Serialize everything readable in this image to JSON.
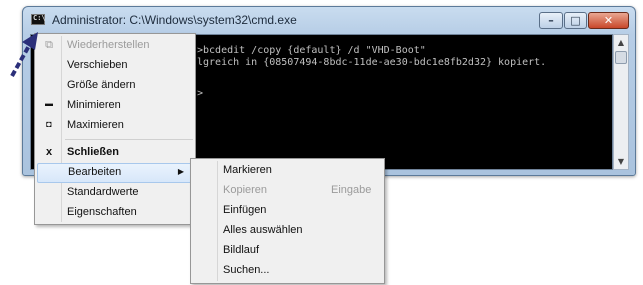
{
  "window": {
    "title": "Administrator: C:\\Windows\\system32\\cmd.exe",
    "controls": {
      "minimize": "–",
      "maximize": "□",
      "close": "✕"
    }
  },
  "console": {
    "lines": [
      ">bcdedit /copy {default} /d \"VHD-Boot\"",
      "lgreich in {08507494-8bdc-11de-ae30-bdc1e8fb2d32} kopiert.",
      ">"
    ]
  },
  "system_menu": {
    "items": [
      {
        "label": "Wiederherstellen",
        "icon": "restore-icon",
        "glyph": "⧉",
        "disabled": true
      },
      {
        "label": "Verschieben"
      },
      {
        "label": "Größe ändern"
      },
      {
        "label": "Minimieren",
        "icon": "minimize-icon",
        "glyph": "▬"
      },
      {
        "label": "Maximieren",
        "icon": "maximize-icon",
        "glyph": "◘"
      },
      {
        "label": "Schließen",
        "icon": "close-icon",
        "glyph": "x",
        "bold": true
      },
      {
        "label": "Bearbeiten",
        "has_submenu": true,
        "highlighted": true
      },
      {
        "label": "Standardwerte"
      },
      {
        "label": "Eigenschaften"
      }
    ]
  },
  "edit_submenu": {
    "items": [
      {
        "label": "Markieren"
      },
      {
        "label": "Kopieren",
        "accelerator": "Eingabe",
        "disabled": true
      },
      {
        "label": "Einfügen"
      },
      {
        "label": "Alles auswählen"
      },
      {
        "label": "Bildlauf"
      },
      {
        "label": "Suchen..."
      }
    ]
  },
  "annotation": {
    "pointer_color": "#2b2f7a"
  }
}
